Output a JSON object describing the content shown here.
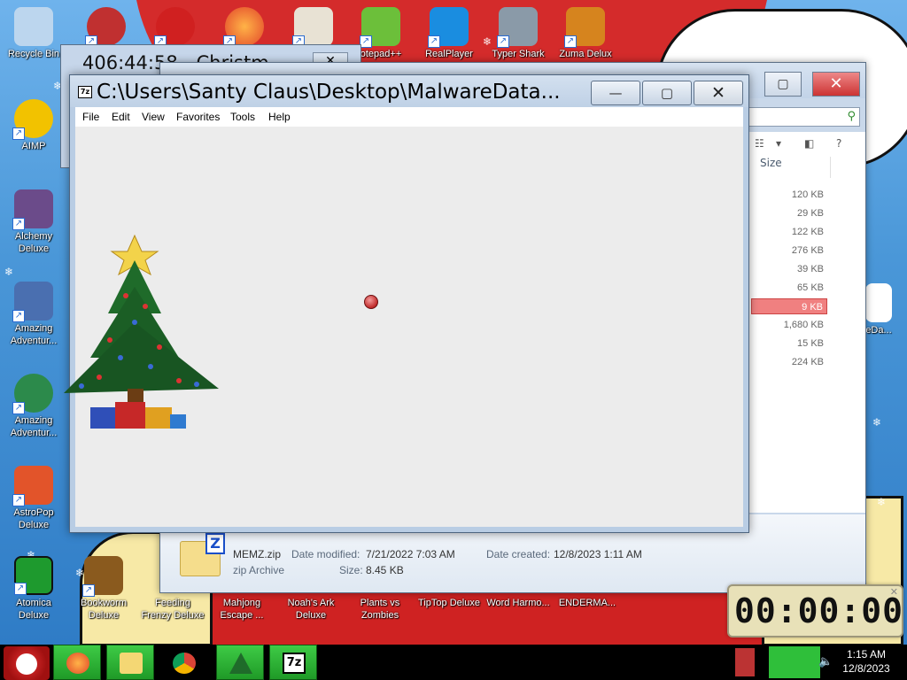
{
  "desktop_icons": [
    {
      "label": "Recycle Bin",
      "color": "#bcd6ee"
    },
    {
      "label": "AIMP",
      "color": "#f2c200"
    },
    {
      "label": "Alchemy Deluxe",
      "color": "#6b4b8a"
    },
    {
      "label": "Amazing Adventur...",
      "color": "#4a6fb0"
    },
    {
      "label": "Amazing Adventur...",
      "color": "#2c8a4b"
    },
    {
      "label": "AstroPop Deluxe",
      "color": "#e2542a"
    },
    {
      "label": "Atomica Deluxe",
      "color": "#1e9a2e"
    },
    {
      "label": "Bookworm Deluxe",
      "color": "#8a5a1e"
    },
    {
      "label": "Feeding Frenzy Deluxe",
      "color": "#2b6fc0"
    },
    {
      "label": "Mahjong Escape ...",
      "color": "#b8862a"
    },
    {
      "label": "Noah's Ark Deluxe",
      "color": "#c65a2e"
    },
    {
      "label": "Plants vs Zombies",
      "color": "#3aa03a"
    },
    {
      "label": "TipTop Deluxe",
      "color": "#3a6ad0"
    },
    {
      "label": "Word Harmo...",
      "color": "#d04040"
    },
    {
      "label": "ENDERMA...",
      "color": "#333333"
    },
    {
      "label": "otepad++",
      "color": "#6cbf3a"
    },
    {
      "label": "RealPlayer",
      "color": "#1a8de0"
    },
    {
      "label": "Typer Shark",
      "color": "#8a9aa8"
    },
    {
      "label": "Zuma Delux",
      "color": "#d6841e"
    },
    {
      "label": "eDa...",
      "color": "#ffffff"
    }
  ],
  "timer_window": {
    "title": "406:44:58 - Christm",
    "close_glyph": "✕"
  },
  "zip_window": {
    "title": "C:\\Users\\Santy Claus\\Desktop\\MalwareData...",
    "app_icon": "7z",
    "controls": {
      "minimize": "—",
      "maximize": "▢",
      "close": "✕"
    },
    "menu": [
      "File",
      "Edit",
      "View",
      "Favorites",
      "Tools",
      "Help"
    ]
  },
  "explorer_window": {
    "controls": {
      "maximize": "▢",
      "close": "✕"
    },
    "size_header": "Size",
    "sizes": [
      "120 KB",
      "29 KB",
      "122 KB",
      "276 KB",
      "39 KB",
      "65 KB",
      "9 KB",
      "1,680 KB",
      "15 KB",
      "224 KB"
    ],
    "selected_index": 6,
    "details": {
      "file_name": "MEMZ.zip",
      "file_type": "zip Archive",
      "date_modified_label": "Date modified:",
      "date_modified": "7/21/2022 7:03 AM",
      "date_created_label": "Date created:",
      "date_created": "12/8/2023 1:11 AM",
      "size_label": "Size:",
      "size": "8.45 KB"
    }
  },
  "digital_clock": {
    "display": "00:00:00"
  },
  "taskbar": {
    "pinned": [
      "firefox-icon",
      "file-explorer-icon",
      "chrome-icon",
      "christmas-tree-icon",
      "7zip-icon"
    ],
    "clock_time": "1:15 AM",
    "clock_date": "12/8/2023"
  }
}
